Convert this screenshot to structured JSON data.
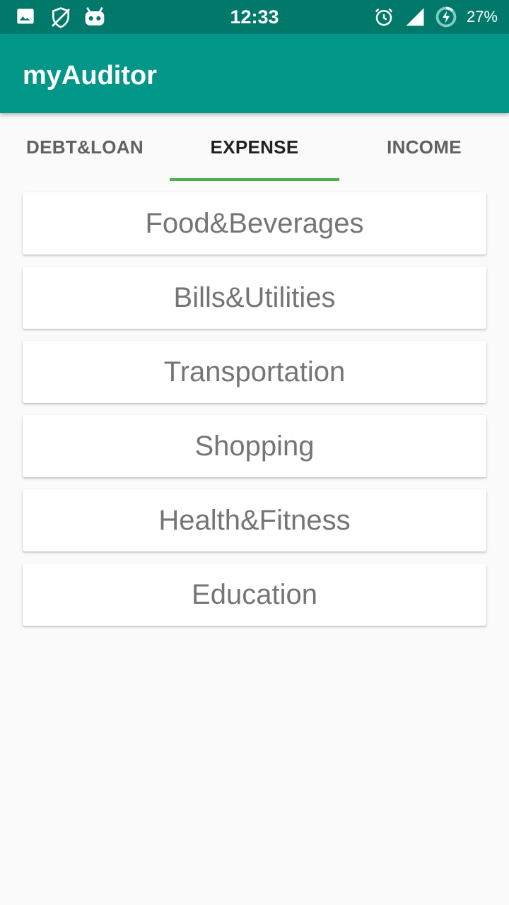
{
  "status_bar": {
    "time": "12:33",
    "battery": "27%",
    "left_icons": [
      "image-icon",
      "vpn-off-icon",
      "android-head-icon"
    ],
    "right_icons": [
      "alarm-icon",
      "signal-icon",
      "battery-charging-icon"
    ]
  },
  "app_bar": {
    "title": "myAuditor",
    "color": "#009688"
  },
  "tabs": [
    {
      "label": "DEBT&LOAN",
      "active": false
    },
    {
      "label": "EXPENSE",
      "active": true
    },
    {
      "label": "INCOME",
      "active": false
    }
  ],
  "indicator_color": "#4caf50",
  "categories": [
    {
      "label": "Food&Beverages"
    },
    {
      "label": "Bills&Utilities"
    },
    {
      "label": "Transportation"
    },
    {
      "label": "Shopping"
    },
    {
      "label": "Health&Fitness"
    },
    {
      "label": "Education"
    }
  ]
}
